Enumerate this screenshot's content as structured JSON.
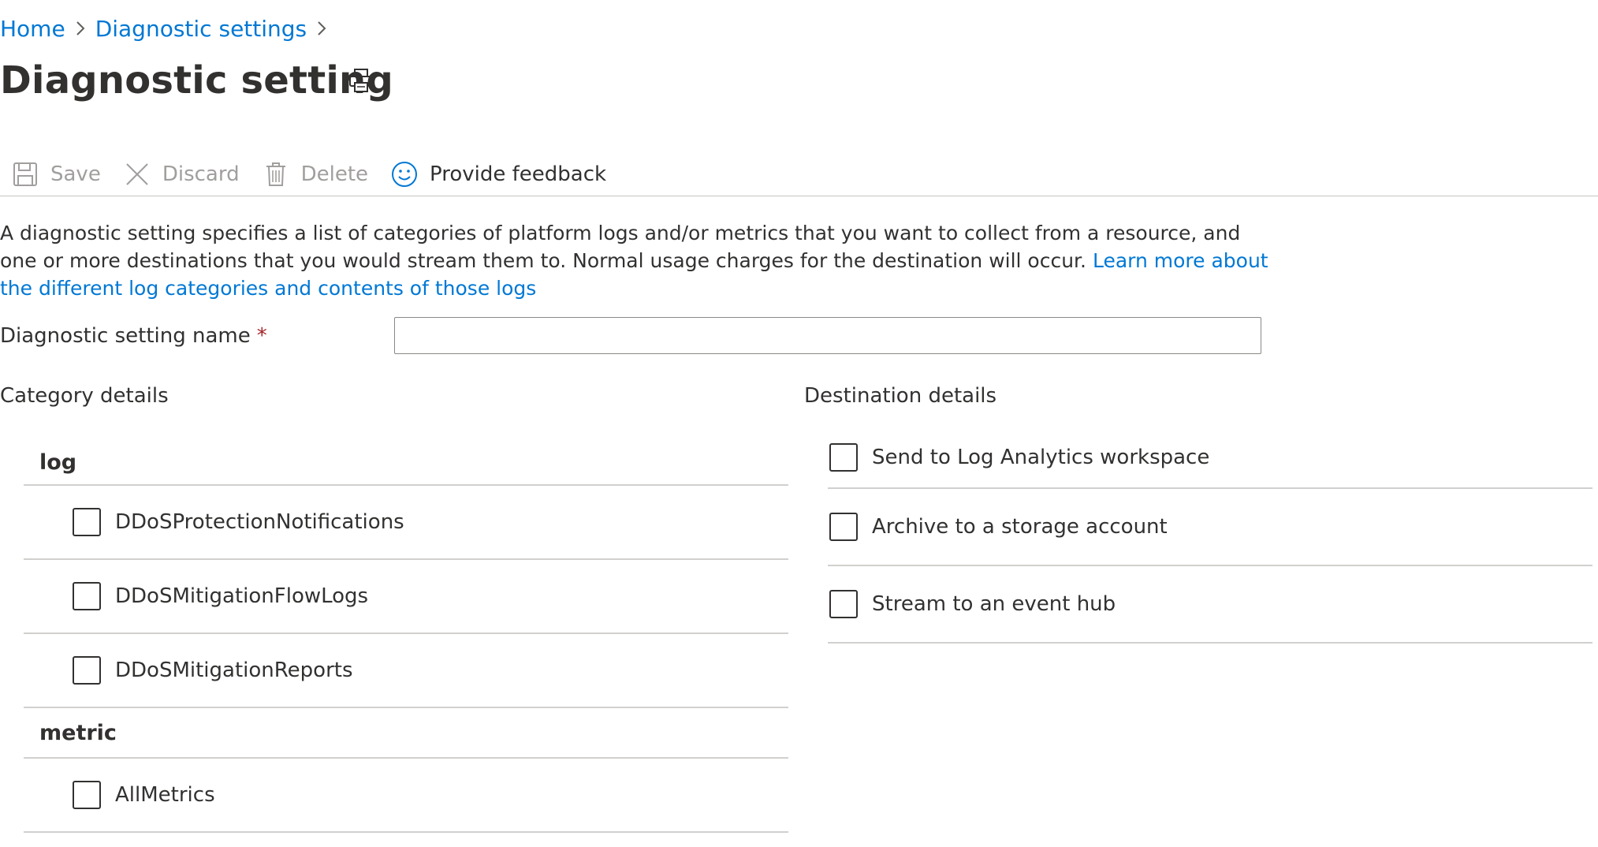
{
  "breadcrumb": {
    "items": [
      {
        "label": "Home"
      },
      {
        "label": "Diagnostic settings"
      }
    ]
  },
  "page": {
    "title": "Diagnostic setting"
  },
  "toolbar": {
    "save_label": "Save",
    "discard_label": "Discard",
    "delete_label": "Delete",
    "feedback_label": "Provide feedback"
  },
  "description": {
    "text": "A diagnostic setting specifies a list of categories of platform logs and/or metrics that you want to collect from a resource, and one or more destinations that you would stream them to. Normal usage charges for the destination will occur.",
    "link_text": "Learn more about the different log categories and contents of those logs"
  },
  "name_field": {
    "label": "Diagnostic setting name",
    "required_marker": "*",
    "value": "",
    "placeholder": ""
  },
  "category_details": {
    "heading": "Category details",
    "log_group": "log",
    "log_items": [
      {
        "label": "DDoSProtectionNotifications",
        "checked": false
      },
      {
        "label": "DDoSMitigationFlowLogs",
        "checked": false
      },
      {
        "label": "DDoSMitigationReports",
        "checked": false
      }
    ],
    "metric_group": "metric",
    "metric_items": [
      {
        "label": "AllMetrics",
        "checked": false
      }
    ]
  },
  "destination_details": {
    "heading": "Destination details",
    "items": [
      {
        "label": "Send to Log Analytics workspace",
        "checked": false
      },
      {
        "label": "Archive to a storage account",
        "checked": false
      },
      {
        "label": "Stream to an event hub",
        "checked": false
      }
    ]
  },
  "colors": {
    "link": "#0078d4",
    "text": "#323130",
    "disabled": "#a19f9d",
    "divider": "#d2d0ce",
    "required": "#a4262c"
  }
}
